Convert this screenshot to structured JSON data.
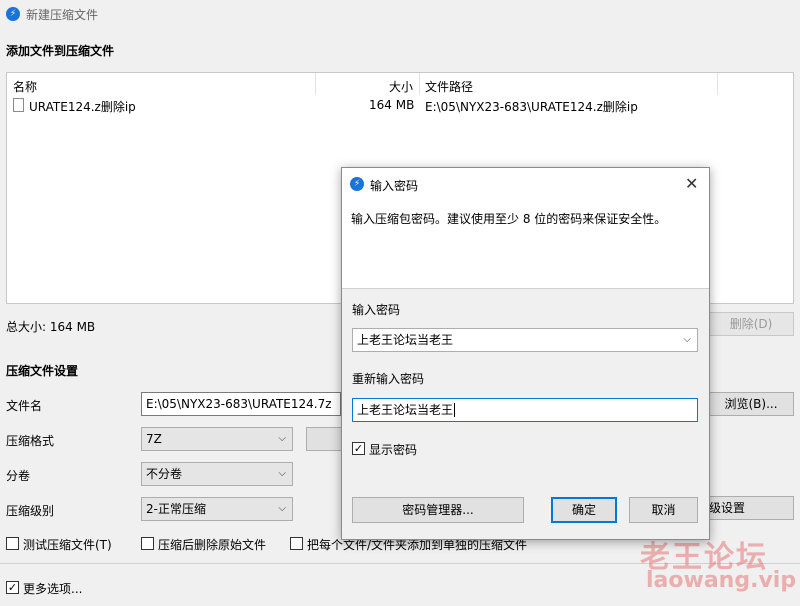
{
  "window": {
    "title": "新建压缩文件"
  },
  "add_section": {
    "title": "添加文件到压缩文件"
  },
  "file_list": {
    "columns": [
      "名称",
      "大小",
      "文件路径"
    ],
    "rows": [
      {
        "name": "URATE124.z删除ip",
        "size": "164 MB",
        "path": "E:\\05\\NYX23-683\\URATE124.z删除ip"
      }
    ]
  },
  "total_size": "总大小: 164 MB",
  "delete_button": "删除(D)",
  "settings": {
    "title": "压缩文件设置",
    "filename_label": "文件名",
    "filename_value": "E:\\05\\NYX23-683\\URATE124.7z",
    "browse_button": "浏览(B)...",
    "format_label": "压缩格式",
    "format_value": "7Z",
    "split_label": "分卷",
    "split_value": "不分卷",
    "level_label": "压缩级别",
    "level_value": "2-正常压缩",
    "advanced_button": "级设置",
    "test_check": "测试压缩文件(T)",
    "delete_check": "压缩后删除原始文件",
    "each_check": "把每个文件/文件夹添加到单独的压缩文件",
    "more_options": "更多选项..."
  },
  "dialog": {
    "title": "输入密码",
    "description": "输入压缩包密码。建议使用至少 8 位的密码来保证安全性。",
    "password_label": "输入密码",
    "password_value": "上老王论坛当老王",
    "reenter_label": "重新输入密码",
    "reenter_value": "上老王论坛当老王",
    "show_password": "显示密码",
    "manager_button": "密码管理器...",
    "ok_button": "确定",
    "cancel_button": "取消"
  },
  "watermark": {
    "cn": "老王论坛",
    "en": "laowang.vip"
  },
  "icons": {
    "app": "app-logo-icon",
    "file": "document-icon",
    "close": "close-icon",
    "dropdown": "chevron-down-icon"
  },
  "colors": {
    "accent": "#0078d7",
    "app_icon": "#1a73d9"
  }
}
